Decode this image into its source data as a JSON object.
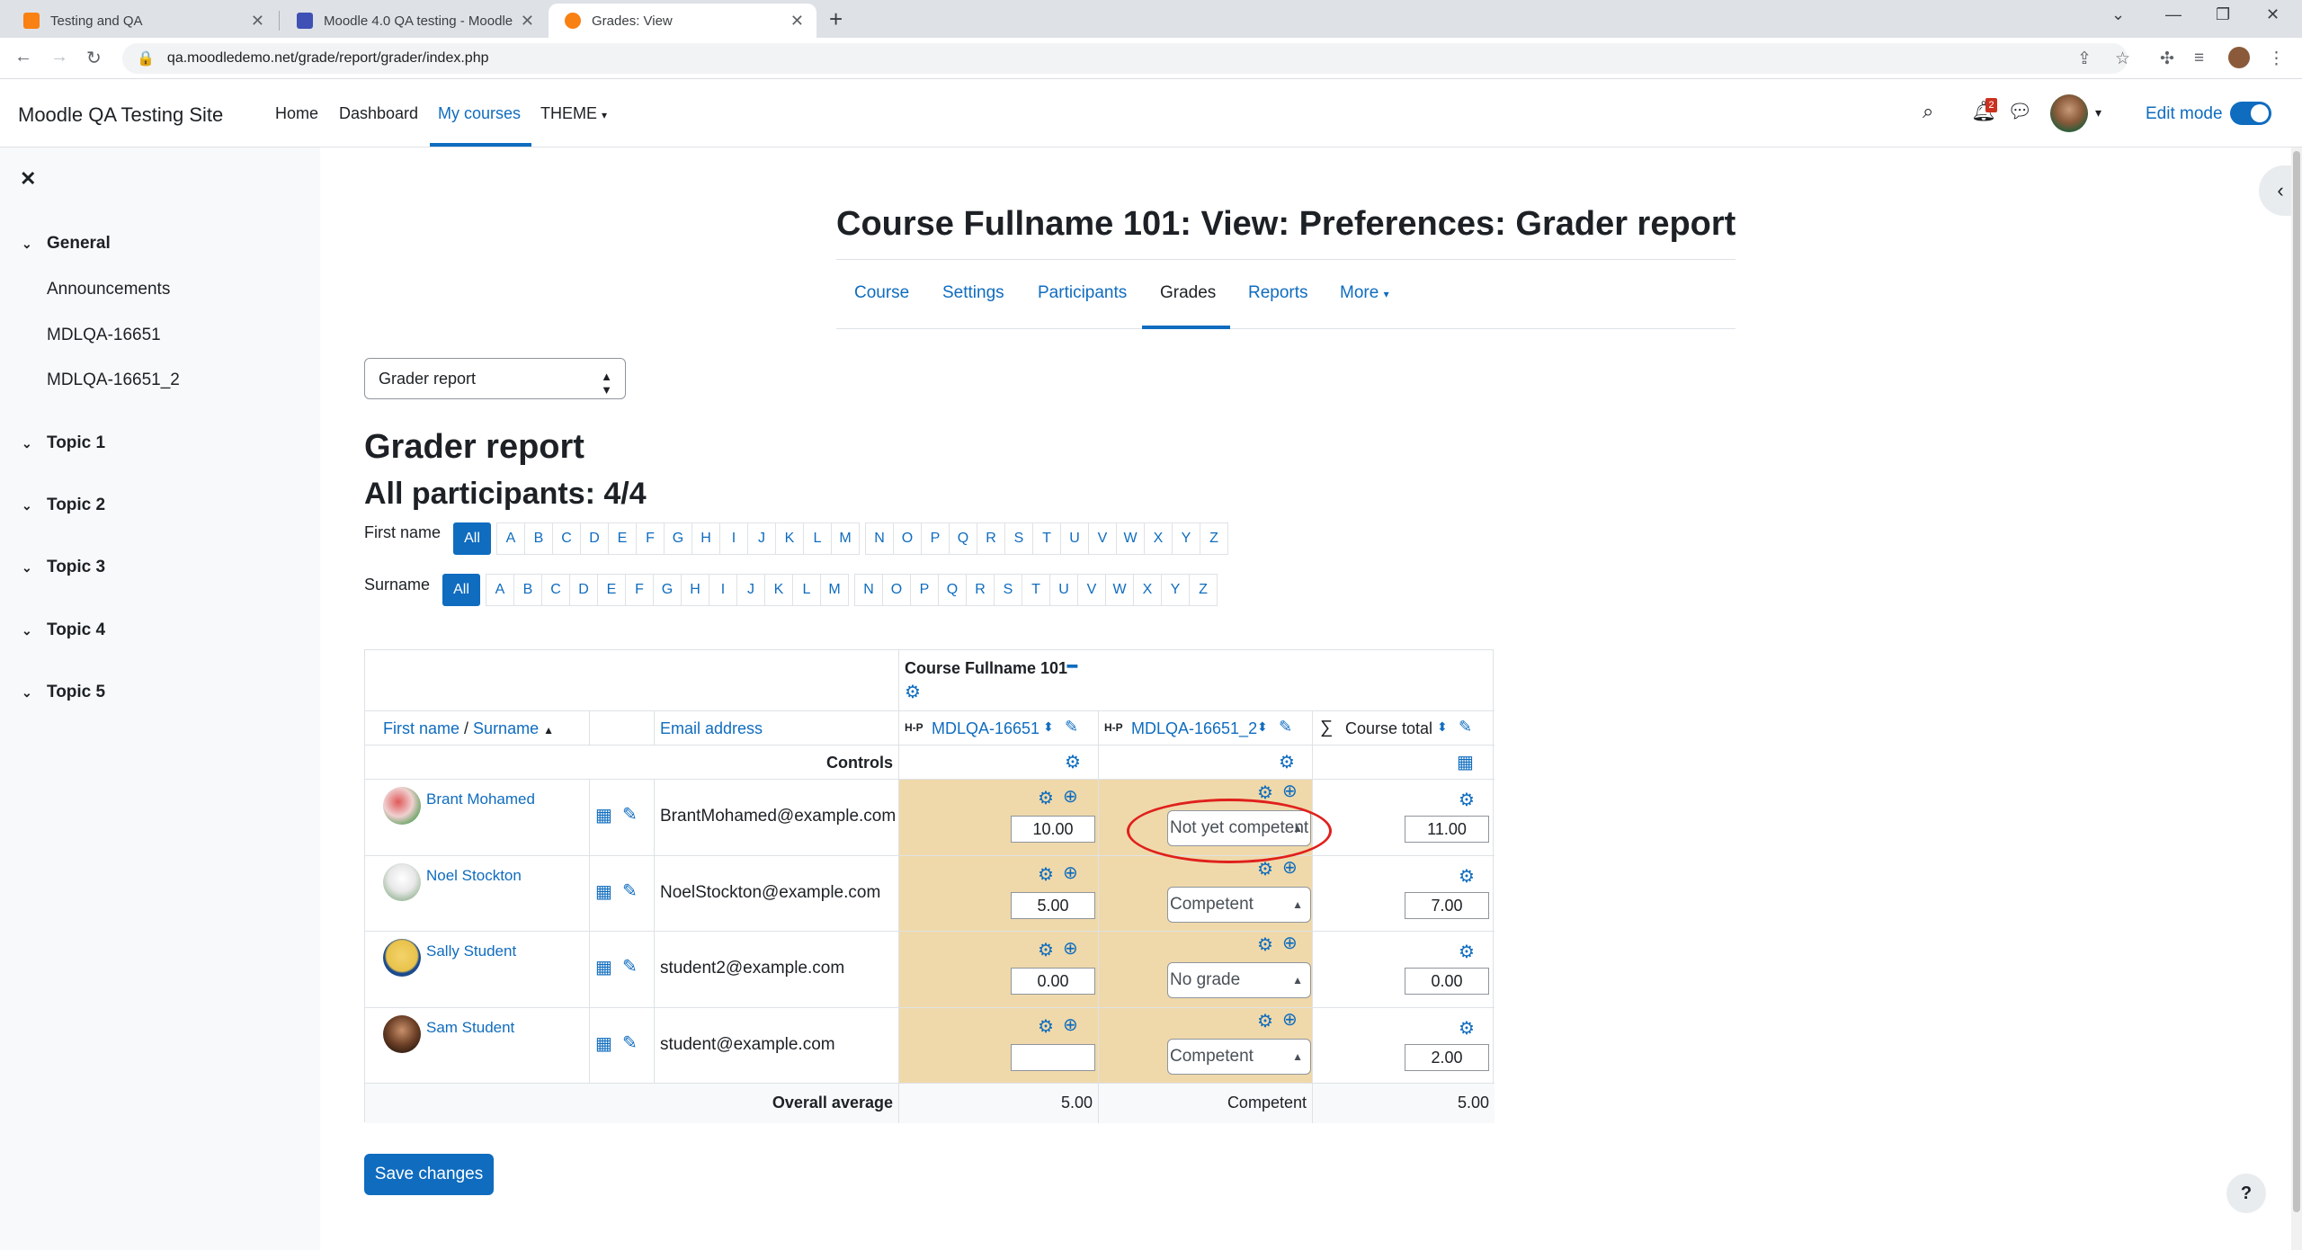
{
  "browser": {
    "tabs": [
      {
        "title": "Testing and QA",
        "active": false
      },
      {
        "title": "Moodle 4.0 QA testing - Moodle",
        "active": false
      },
      {
        "title": "Grades: View",
        "active": true
      }
    ],
    "url": "qa.moodledemo.net/grade/report/grader/index.php"
  },
  "header": {
    "site_name": "Moodle QA Testing Site",
    "nav": [
      "Home",
      "Dashboard",
      "My courses",
      "THEME"
    ],
    "active_nav": "My courses",
    "notification_count": "2",
    "edit_mode_label": "Edit mode"
  },
  "drawer": {
    "sections": [
      {
        "label": "General",
        "items": [
          "Announcements",
          "MDLQA-16651",
          "MDLQA-16651_2"
        ]
      },
      {
        "label": "Topic 1",
        "items": []
      },
      {
        "label": "Topic 2",
        "items": []
      },
      {
        "label": "Topic 3",
        "items": []
      },
      {
        "label": "Topic 4",
        "items": []
      },
      {
        "label": "Topic 5",
        "items": []
      }
    ]
  },
  "page": {
    "course_title": "Course Fullname 101: View: Preferences: Grader report",
    "secondary_nav": [
      "Course",
      "Settings",
      "Participants",
      "Grades",
      "Reports",
      "More"
    ],
    "active_secondary": "Grades",
    "report_select": "Grader report",
    "report_title": "Grader report",
    "participants": "All participants: 4/4",
    "firstname_label": "First name",
    "surname_label": "Surname",
    "all_label": "All",
    "letters": [
      "A",
      "B",
      "C",
      "D",
      "E",
      "F",
      "G",
      "H",
      "I",
      "J",
      "K",
      "L",
      "M",
      "N",
      "O",
      "P",
      "Q",
      "R",
      "S",
      "T",
      "U",
      "V",
      "W",
      "X",
      "Y",
      "Z"
    ]
  },
  "grader": {
    "course_header": "Course Fullname 101",
    "col_name_first": "First name",
    "col_name_sep": " / ",
    "col_name_last": "Surname",
    "col_email": "Email address",
    "col_item1": "MDLQA-16651",
    "col_item2": "MDLQA-16651_2",
    "col_total": "Course total",
    "controls_label": "Controls",
    "rows": [
      {
        "name": "Brant Mohamed",
        "email": "BrantMohamed@example.com",
        "grade1": "10.00",
        "grade2": "Not yet competent",
        "total": "11.00"
      },
      {
        "name": "Noel Stockton",
        "email": "NoelStockton@example.com",
        "grade1": "5.00",
        "grade2": "Competent",
        "total": "7.00"
      },
      {
        "name": "Sally Student",
        "email": "student2@example.com",
        "grade1": "0.00",
        "grade2": "No grade",
        "total": "0.00"
      },
      {
        "name": "Sam Student",
        "email": "student@example.com",
        "grade1": "",
        "grade2": "Competent",
        "total": "2.00"
      }
    ],
    "overall_label": "Overall average",
    "overall_item1": "5.00",
    "overall_item2": "Competent",
    "overall_total": "5.00"
  },
  "save_label": "Save changes",
  "help_label": "?"
}
